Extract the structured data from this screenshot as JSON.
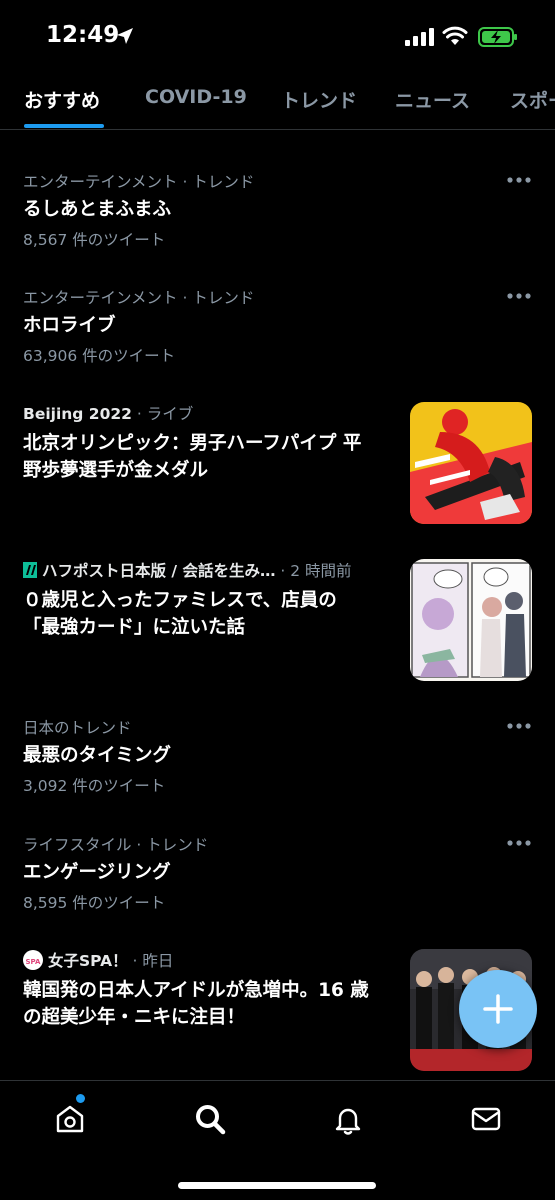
{
  "status_bar": {
    "time": "12:49"
  },
  "tabs": [
    {
      "label": "おすすめ",
      "active": true
    },
    {
      "label": "COVID-19"
    },
    {
      "label": "トレンド"
    },
    {
      "label": "ニュース"
    },
    {
      "label": "スポー"
    }
  ],
  "feed": [
    {
      "context": "エンターテインメント · トレンド",
      "title": "るしあとまふまふ",
      "count": "8,567 件のツイート"
    },
    {
      "context": "エンターテインメント · トレンド",
      "title": "ホロライブ",
      "count": "63,906 件のツイート"
    },
    {
      "context_source": "Beijing 2022",
      "context_suffix": " · ライブ",
      "title_line1": "北京オリンピック：男子ハーフパイプ 平",
      "title_line2": "野歩夢選手が金メダル",
      "thumb_icon": "olympics-snowboard-image"
    },
    {
      "context_source": "ハフポスト日本版 / 会話を生み…",
      "context_suffix": " · 2 時間前",
      "title_line1": "０歳児と入ったファミレスで、店員の",
      "title_line2": "「最強カード」に泣いた話",
      "thumb_icon": "manga-comic-image"
    },
    {
      "context": "日本のトレンド",
      "title": "最悪のタイミング",
      "count": "3,092 件のツイート"
    },
    {
      "context": "ライフスタイル · トレンド",
      "title": "エンゲージリング",
      "count": "8,595 件のツイート"
    },
    {
      "context_source": "女子SPA！",
      "context_suffix": " · 昨日",
      "title_line1": "韓国発の日本人アイドルが急増中。16 歳",
      "title_line2": "の超美少年・ニキに注目！",
      "thumb_icon": "idol-group-photo"
    }
  ],
  "fab": {
    "icon": "plus-icon"
  },
  "bottom_nav": [
    {
      "icon": "home-icon"
    },
    {
      "icon": "search-icon",
      "active": true
    },
    {
      "icon": "bell-icon"
    },
    {
      "icon": "mail-icon"
    }
  ],
  "colors": {
    "accent": "#1d9bf0",
    "fab": "#79c3f5",
    "background": "#000000",
    "secondary_text": "#8b98a5"
  }
}
